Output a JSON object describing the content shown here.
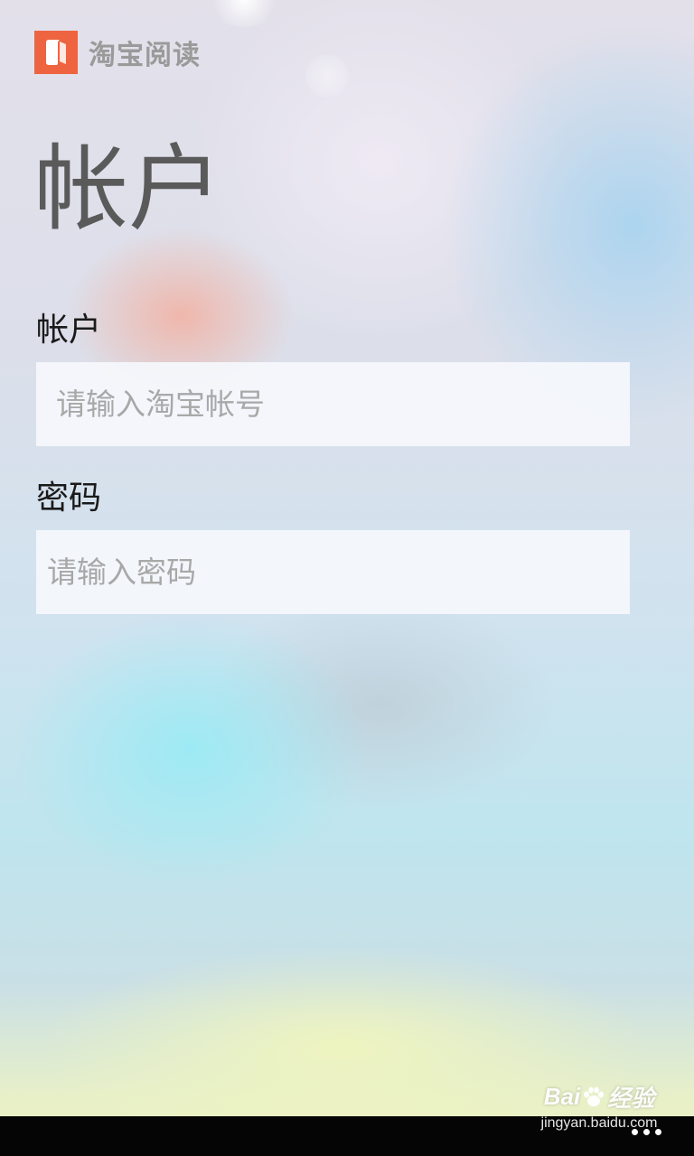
{
  "brand": {
    "name": "淘宝阅读",
    "icon": "open-book-icon",
    "color": "#ee6440"
  },
  "page": {
    "title": "帐户"
  },
  "form": {
    "account": {
      "label": "帐户",
      "value": "",
      "placeholder": "请输入淘宝帐号"
    },
    "password": {
      "label": "密码",
      "value": "",
      "placeholder": "请输入密码"
    }
  },
  "app_bar": {
    "more_icon": "ellipsis-icon"
  },
  "watermark": {
    "brand_text": "Bai",
    "suffix_text": "经验",
    "url": "jingyan.baidu.com"
  }
}
